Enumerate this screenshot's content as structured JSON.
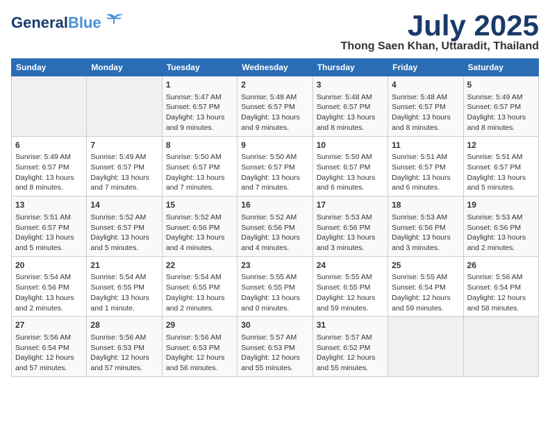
{
  "header": {
    "logo_general": "General",
    "logo_blue": "Blue",
    "month_title": "July 2025",
    "location": "Thong Saen Khan, Uttaradit, Thailand"
  },
  "weekdays": [
    "Sunday",
    "Monday",
    "Tuesday",
    "Wednesday",
    "Thursday",
    "Friday",
    "Saturday"
  ],
  "weeks": [
    [
      {
        "day": "",
        "info": ""
      },
      {
        "day": "",
        "info": ""
      },
      {
        "day": "1",
        "info": "Sunrise: 5:47 AM\nSunset: 6:57 PM\nDaylight: 13 hours\nand 9 minutes."
      },
      {
        "day": "2",
        "info": "Sunrise: 5:48 AM\nSunset: 6:57 PM\nDaylight: 13 hours\nand 9 minutes."
      },
      {
        "day": "3",
        "info": "Sunrise: 5:48 AM\nSunset: 6:57 PM\nDaylight: 13 hours\nand 8 minutes."
      },
      {
        "day": "4",
        "info": "Sunrise: 5:48 AM\nSunset: 6:57 PM\nDaylight: 13 hours\nand 8 minutes."
      },
      {
        "day": "5",
        "info": "Sunrise: 5:49 AM\nSunset: 6:57 PM\nDaylight: 13 hours\nand 8 minutes."
      }
    ],
    [
      {
        "day": "6",
        "info": "Sunrise: 5:49 AM\nSunset: 6:57 PM\nDaylight: 13 hours\nand 8 minutes."
      },
      {
        "day": "7",
        "info": "Sunrise: 5:49 AM\nSunset: 6:57 PM\nDaylight: 13 hours\nand 7 minutes."
      },
      {
        "day": "8",
        "info": "Sunrise: 5:50 AM\nSunset: 6:57 PM\nDaylight: 13 hours\nand 7 minutes."
      },
      {
        "day": "9",
        "info": "Sunrise: 5:50 AM\nSunset: 6:57 PM\nDaylight: 13 hours\nand 7 minutes."
      },
      {
        "day": "10",
        "info": "Sunrise: 5:50 AM\nSunset: 6:57 PM\nDaylight: 13 hours\nand 6 minutes."
      },
      {
        "day": "11",
        "info": "Sunrise: 5:51 AM\nSunset: 6:57 PM\nDaylight: 13 hours\nand 6 minutes."
      },
      {
        "day": "12",
        "info": "Sunrise: 5:51 AM\nSunset: 6:57 PM\nDaylight: 13 hours\nand 5 minutes."
      }
    ],
    [
      {
        "day": "13",
        "info": "Sunrise: 5:51 AM\nSunset: 6:57 PM\nDaylight: 13 hours\nand 5 minutes."
      },
      {
        "day": "14",
        "info": "Sunrise: 5:52 AM\nSunset: 6:57 PM\nDaylight: 13 hours\nand 5 minutes."
      },
      {
        "day": "15",
        "info": "Sunrise: 5:52 AM\nSunset: 6:56 PM\nDaylight: 13 hours\nand 4 minutes."
      },
      {
        "day": "16",
        "info": "Sunrise: 5:52 AM\nSunset: 6:56 PM\nDaylight: 13 hours\nand 4 minutes."
      },
      {
        "day": "17",
        "info": "Sunrise: 5:53 AM\nSunset: 6:56 PM\nDaylight: 13 hours\nand 3 minutes."
      },
      {
        "day": "18",
        "info": "Sunrise: 5:53 AM\nSunset: 6:56 PM\nDaylight: 13 hours\nand 3 minutes."
      },
      {
        "day": "19",
        "info": "Sunrise: 5:53 AM\nSunset: 6:56 PM\nDaylight: 13 hours\nand 2 minutes."
      }
    ],
    [
      {
        "day": "20",
        "info": "Sunrise: 5:54 AM\nSunset: 6:56 PM\nDaylight: 13 hours\nand 2 minutes."
      },
      {
        "day": "21",
        "info": "Sunrise: 5:54 AM\nSunset: 6:55 PM\nDaylight: 13 hours\nand 1 minute."
      },
      {
        "day": "22",
        "info": "Sunrise: 5:54 AM\nSunset: 6:55 PM\nDaylight: 13 hours\nand 2 minutes."
      },
      {
        "day": "23",
        "info": "Sunrise: 5:55 AM\nSunset: 6:55 PM\nDaylight: 13 hours\nand 0 minutes."
      },
      {
        "day": "24",
        "info": "Sunrise: 5:55 AM\nSunset: 6:55 PM\nDaylight: 12 hours\nand 59 minutes."
      },
      {
        "day": "25",
        "info": "Sunrise: 5:55 AM\nSunset: 6:54 PM\nDaylight: 12 hours\nand 59 minutes."
      },
      {
        "day": "26",
        "info": "Sunrise: 5:56 AM\nSunset: 6:54 PM\nDaylight: 12 hours\nand 58 minutes."
      }
    ],
    [
      {
        "day": "27",
        "info": "Sunrise: 5:56 AM\nSunset: 6:54 PM\nDaylight: 12 hours\nand 57 minutes."
      },
      {
        "day": "28",
        "info": "Sunrise: 5:56 AM\nSunset: 6:53 PM\nDaylight: 12 hours\nand 57 minutes."
      },
      {
        "day": "29",
        "info": "Sunrise: 5:56 AM\nSunset: 6:53 PM\nDaylight: 12 hours\nand 56 minutes."
      },
      {
        "day": "30",
        "info": "Sunrise: 5:57 AM\nSunset: 6:53 PM\nDaylight: 12 hours\nand 55 minutes."
      },
      {
        "day": "31",
        "info": "Sunrise: 5:57 AM\nSunset: 6:52 PM\nDaylight: 12 hours\nand 55 minutes."
      },
      {
        "day": "",
        "info": ""
      },
      {
        "day": "",
        "info": ""
      }
    ]
  ]
}
